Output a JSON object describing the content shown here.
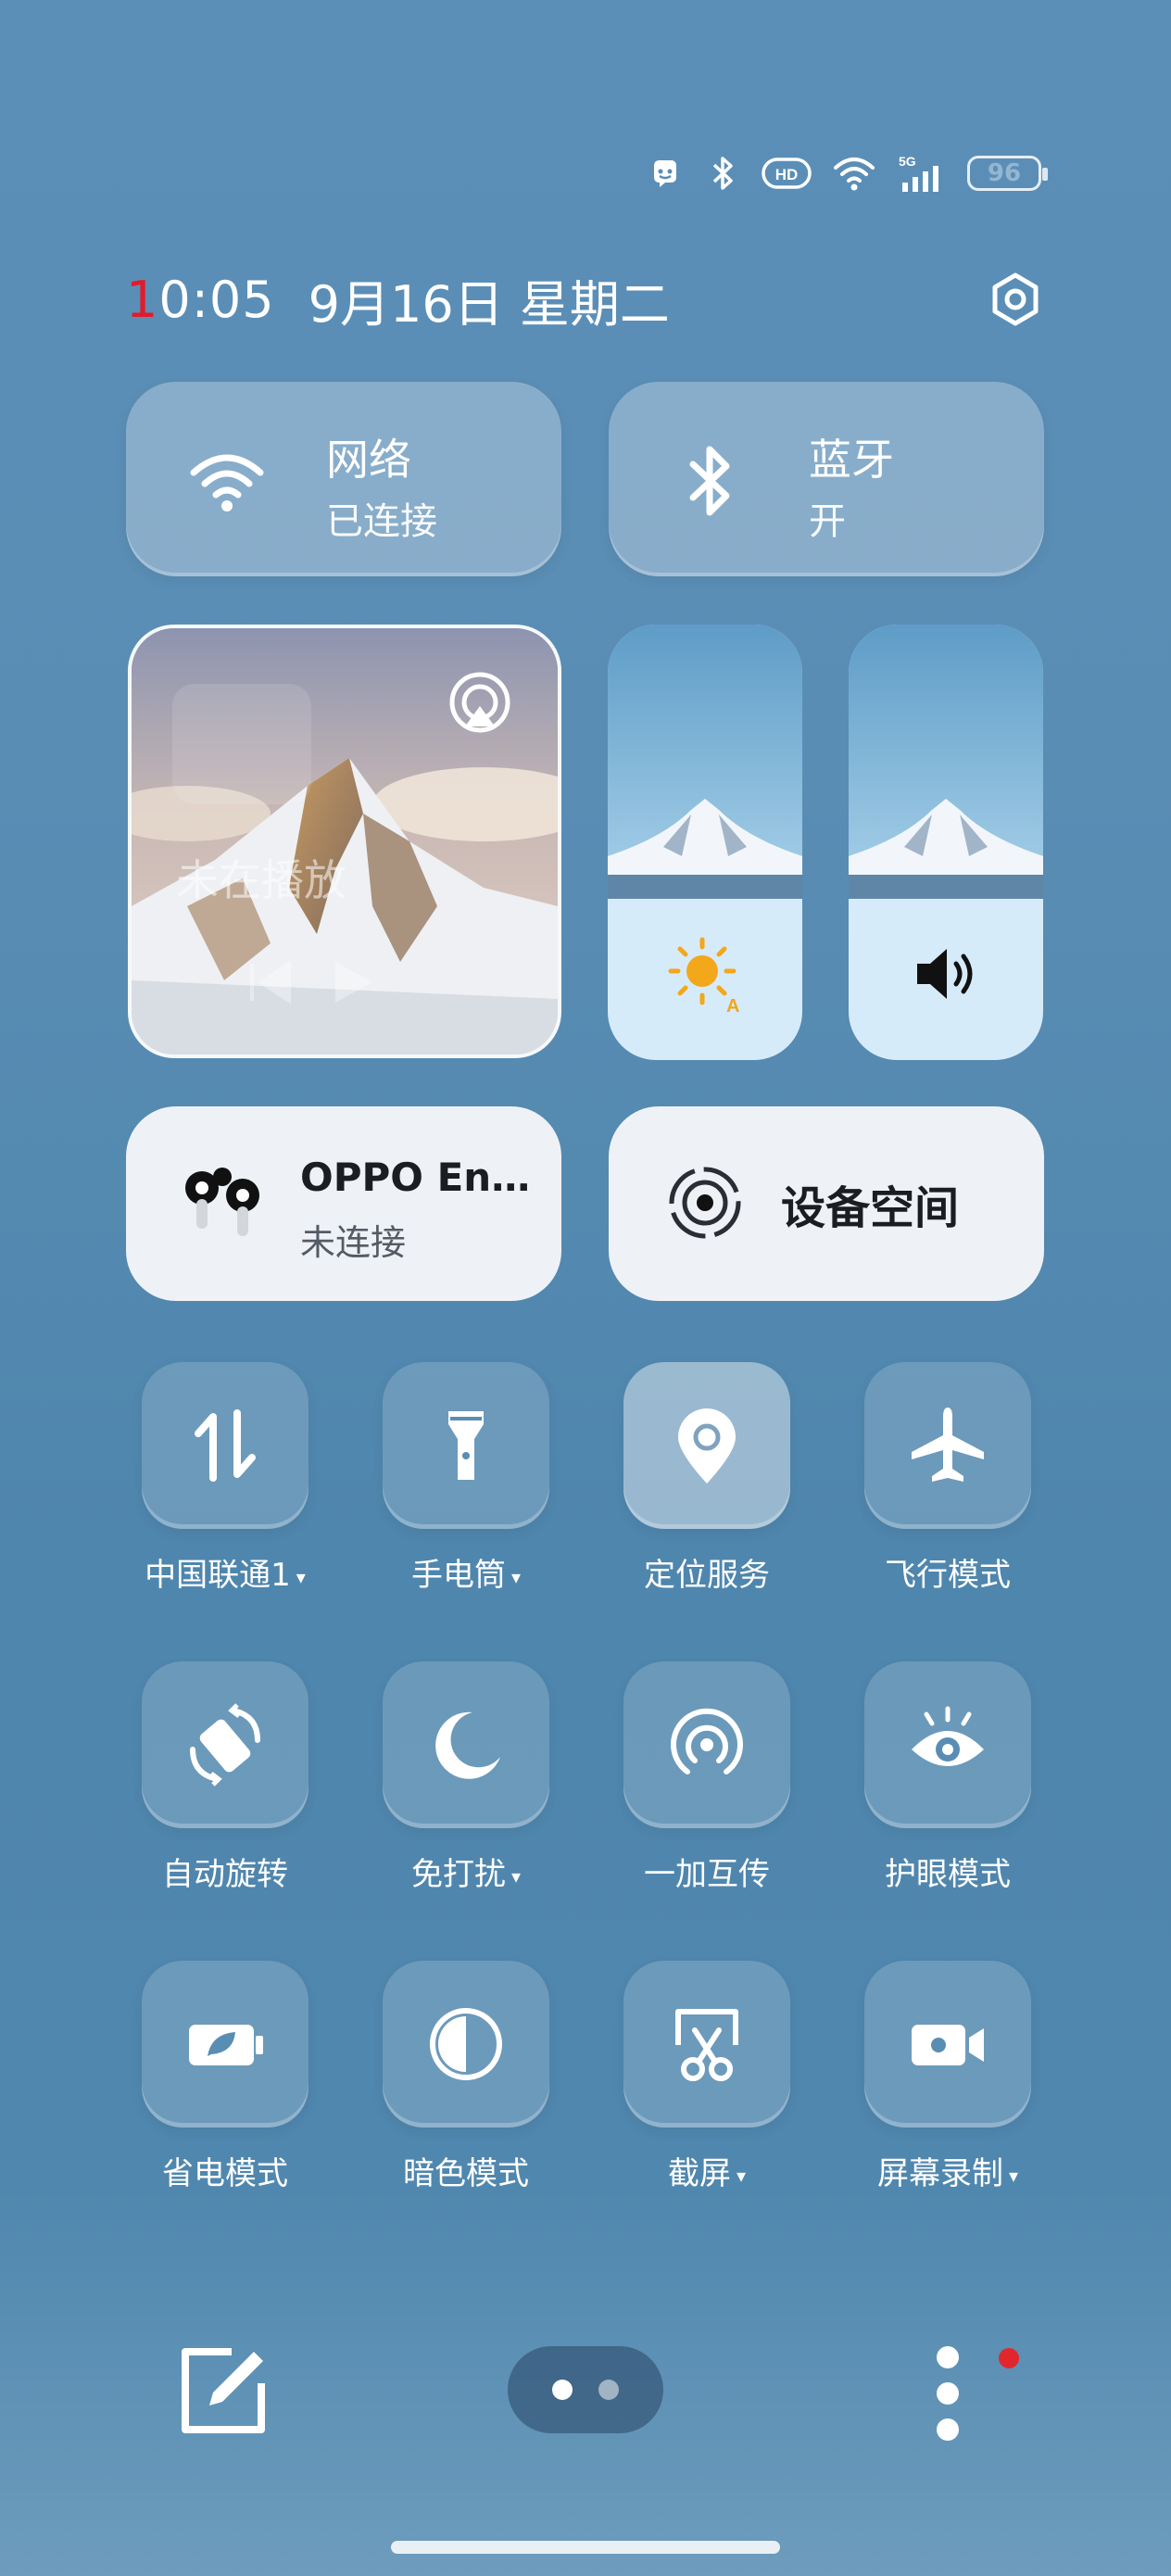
{
  "status_bar": {
    "icons": [
      "notification-icon",
      "bluetooth-icon",
      "hd-icon",
      "wifi-icon",
      "5g-signal-icon"
    ],
    "network_type": "5G",
    "battery": "96"
  },
  "header": {
    "time": "10:05",
    "time_first_char": "1",
    "time_rest": "0:05",
    "date": "9月16日 星期二"
  },
  "network_tile": {
    "title": "网络",
    "status": "已连接"
  },
  "bluetooth_tile": {
    "title": "蓝牙",
    "status": "开"
  },
  "media": {
    "status": "未在播放"
  },
  "enco_tile": {
    "title": "OPPO Enco...",
    "status": "未连接"
  },
  "device_space_tile": {
    "title": "设备空间"
  },
  "toggles": [
    {
      "label": "中国联通1",
      "icon": "mobile-data-icon",
      "has_menu": true,
      "active": false
    },
    {
      "label": "手电筒",
      "icon": "flashlight-icon",
      "has_menu": true,
      "active": false
    },
    {
      "label": "定位服务",
      "icon": "location-icon",
      "has_menu": false,
      "active": true
    },
    {
      "label": "飞行模式",
      "icon": "airplane-icon",
      "has_menu": false,
      "active": false
    },
    {
      "label": "自动旋转",
      "icon": "auto-rotate-icon",
      "has_menu": false,
      "active": false
    },
    {
      "label": "免打扰",
      "icon": "moon-icon",
      "has_menu": true,
      "active": false
    },
    {
      "label": "一加互传",
      "icon": "share-icon",
      "has_menu": false,
      "active": false
    },
    {
      "label": "护眼模式",
      "icon": "eye-icon",
      "has_menu": false,
      "active": false
    },
    {
      "label": "省电模式",
      "icon": "battery-saver-icon",
      "has_menu": false,
      "active": false
    },
    {
      "label": "暗色模式",
      "icon": "dark-mode-icon",
      "has_menu": false,
      "active": false
    },
    {
      "label": "截屏",
      "icon": "screenshot-icon",
      "has_menu": true,
      "active": false
    },
    {
      "label": "屏幕录制",
      "icon": "screen-record-icon",
      "has_menu": true,
      "active": false
    }
  ],
  "caret": "▾",
  "pager": {
    "pages": 2,
    "current": 1
  },
  "colors": {
    "accent_red": "#e21b2a",
    "sun_yellow": "#f3a71b"
  }
}
